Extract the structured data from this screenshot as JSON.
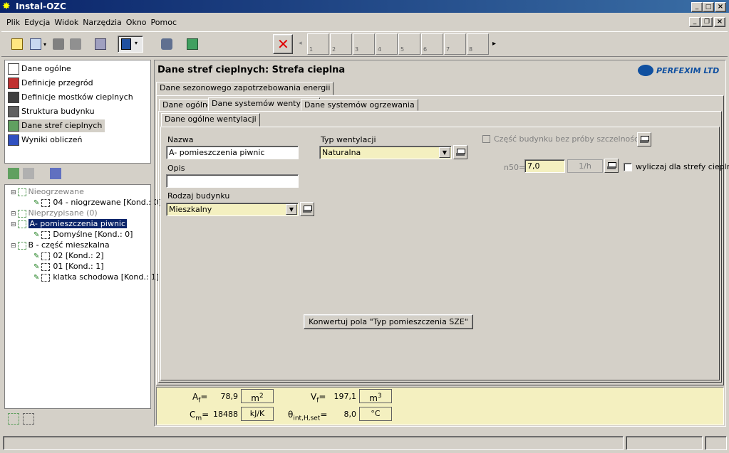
{
  "window": {
    "title": "Instal-OZC"
  },
  "menu": [
    "Plik",
    "Edycja",
    "Widok",
    "Narzędzia",
    "Okno",
    "Pomoc"
  ],
  "pages": [
    "1",
    "2",
    "3",
    "4",
    "5",
    "6",
    "7",
    "8"
  ],
  "nav": [
    {
      "label": "Dane ogólne",
      "icon": "document-icon"
    },
    {
      "label": "Definicje przegród",
      "icon": "wall-icon"
    },
    {
      "label": "Definicje mostków cieplnych",
      "icon": "bridge-icon"
    },
    {
      "label": "Struktura budynku",
      "icon": "structure-icon"
    },
    {
      "label": "Dane stref cieplnych",
      "icon": "zone-icon"
    },
    {
      "label": "Wyniki obliczeń",
      "icon": "results-icon"
    }
  ],
  "tree": [
    {
      "label": "Nieogrzewane",
      "level": 0,
      "muted": true
    },
    {
      "label": "04 - niogrzewane [Kond.: 0]",
      "level": 1
    },
    {
      "label": "Nieprzypisane (0)",
      "level": 0,
      "muted": true
    },
    {
      "label": "A- pomieszczenia piwnic",
      "level": 0,
      "selected": true
    },
    {
      "label": "Domyślne [Kond.: 0]",
      "level": 1
    },
    {
      "label": "B - część mieszkalna",
      "level": 0
    },
    {
      "label": "02 [Kond.: 2]",
      "level": 1
    },
    {
      "label": "01 [Kond.: 1]",
      "level": 1
    },
    {
      "label": "klatka schodowa [Kond.: 1]",
      "level": 1
    }
  ],
  "header": {
    "title": "Dane stref cieplnych: Strefa cieplna",
    "logo": "PERFEXIM LTD"
  },
  "tabs_top": [
    "Dane sezonowego zapotrzebowania energii"
  ],
  "tabs_mid": [
    "Dane ogólne",
    "Dane systemów wentylacji",
    "Dane systemów ogrzewania"
  ],
  "tabs_inner": [
    "Dane ogólne wentylacji"
  ],
  "form": {
    "nazwa_label": "Nazwa",
    "nazwa_value": "A- pomieszczenia piwnic",
    "opis_label": "Opis",
    "opis_value": "",
    "rodzaj_label": "Rodzaj budynku",
    "rodzaj_value": "Mieszkalny",
    "typ_label": "Typ wentylacji",
    "typ_value": "Naturalna",
    "czesc_label": "Część budynku bez próby szczelności",
    "n50_label": "n50=",
    "n50_value": "7,0",
    "n50_unit": "1/h",
    "wyliczaj_label": "wyliczaj dla strefy cieplnej",
    "convert_button": "Konwertuj pola \"Typ pomieszczenia SZE\""
  },
  "summary": {
    "af_label": "A",
    "af_sub": "f",
    "af_eq": "=",
    "af_value": "78,9",
    "af_unit": "m",
    "af_unit_sup": "2",
    "vf_label": "V",
    "vf_sub": "f",
    "vf_eq": "=",
    "vf_value": "197,1",
    "vf_unit": "m",
    "vf_unit_sup": "3",
    "cm_label": "C",
    "cm_sub": "m",
    "cm_eq": "=",
    "cm_value": "18488",
    "cm_unit": "kJ/K",
    "theta_label": "θ",
    "theta_sub": "int,H,set",
    "theta_eq": "=",
    "theta_value": "8,0",
    "theta_unit": "°C"
  }
}
